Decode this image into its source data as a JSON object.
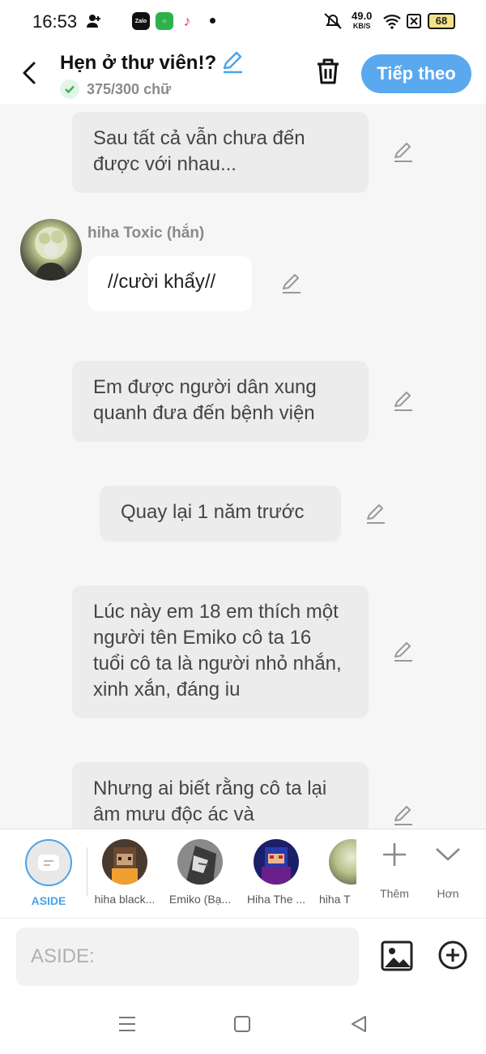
{
  "status_bar": {
    "time": "16:53",
    "apps": [
      "Zalo",
      "wechat-icon",
      "tiktok-icon"
    ],
    "net_speed": "49.0",
    "net_unit": "KB/S",
    "battery": "68"
  },
  "header": {
    "title": "Hẹn ở thư viên!?",
    "word_count": "375/300 chữ",
    "next_label": "Tiếp theo"
  },
  "messages": [
    {
      "text": "Sau tất cả vẫn chưa đến được với nhau...",
      "style": "aside"
    },
    {
      "speaker": "hiha Toxic (hắn)",
      "text": "//cười khẩy//",
      "style": "character"
    },
    {
      "text": "Em được người dân xung quanh đưa đến bệnh viện",
      "style": "aside"
    },
    {
      "text": "Quay lại 1 năm trước",
      "style": "aside"
    },
    {
      "text": "Lúc này em 18 em thích một người tên Emiko cô ta 16 tuổi cô ta là người nhỏ nhắn, xinh xắn, đáng iu",
      "style": "aside"
    },
    {
      "text": "Nhưng ai biết rằng cô ta lại âm mưu độc ác và",
      "style": "aside"
    }
  ],
  "characters": [
    {
      "label": "ASIDE",
      "selected": true
    },
    {
      "label": "hiha black..."
    },
    {
      "label": "Emiko (Bạ..."
    },
    {
      "label": "Hiha The ..."
    },
    {
      "label": "hiha T"
    }
  ],
  "picker_actions": {
    "add_label": "Thêm",
    "more_label": "Hơn"
  },
  "input": {
    "placeholder": "ASIDE:"
  },
  "colors": {
    "accent": "#5aa9ef",
    "bubble": "#ececec",
    "background": "#f6f6f6"
  }
}
